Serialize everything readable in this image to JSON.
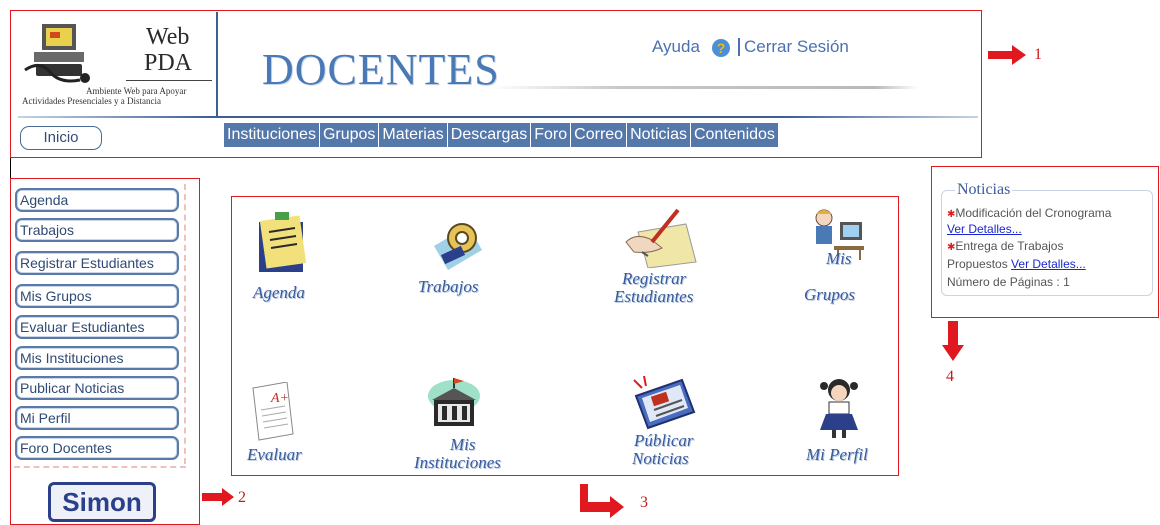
{
  "header": {
    "logo_web": "Web",
    "logo_pda": "PDA",
    "logo_subtitle_1": "Ambiente Web para Apoyar",
    "logo_subtitle_2": "Actividades Presenciales y a Distancia",
    "title": "DOCENTES",
    "help_label": "Ayuda",
    "logout_label": "Cerrar Sesión",
    "home_button": "Inicio",
    "nav": [
      "Instituciones",
      "Grupos",
      "Materias",
      "Descargas",
      "Foro",
      "Correo",
      "Noticias",
      "Contenidos"
    ]
  },
  "sidebar": {
    "items": [
      "Agenda",
      "Trabajos",
      "Registrar Estudiantes",
      "Mis Grupos",
      "Evaluar Estudiantes",
      "Mis Instituciones",
      "Publicar Noticias",
      "Mi Perfil",
      "Foro Docentes"
    ],
    "logo_text": "Simon"
  },
  "main": {
    "icons": [
      {
        "label_1": "Agenda",
        "label_2": ""
      },
      {
        "label_1": "Trabajos",
        "label_2": ""
      },
      {
        "label_1": "Registrar",
        "label_2": "Estudiantes"
      },
      {
        "label_1": "Mis",
        "label_2": "Grupos"
      },
      {
        "label_1": "Evaluar",
        "label_2": ""
      },
      {
        "label_1": "Mis",
        "label_2": "Instituciones"
      },
      {
        "label_1": "Públicar",
        "label_2": "Noticias"
      },
      {
        "label_1": "Mi Perfil",
        "label_2": ""
      }
    ]
  },
  "news": {
    "title": "Noticias",
    "item_1": "Modificación del Cronograma",
    "item_1_link": "Ver Detalles...",
    "item_2_a": "Entrega de Trabajos",
    "item_2_b": "Propuestos",
    "item_2_link": "Ver Detalles...",
    "pages": "Número de Páginas : 1"
  },
  "callouts": [
    "1",
    "2",
    "3",
    "4"
  ],
  "colors": {
    "annotation_red": "#e0181f",
    "nav_blue": "#5578ab",
    "link_blue": "#1a26d1"
  }
}
